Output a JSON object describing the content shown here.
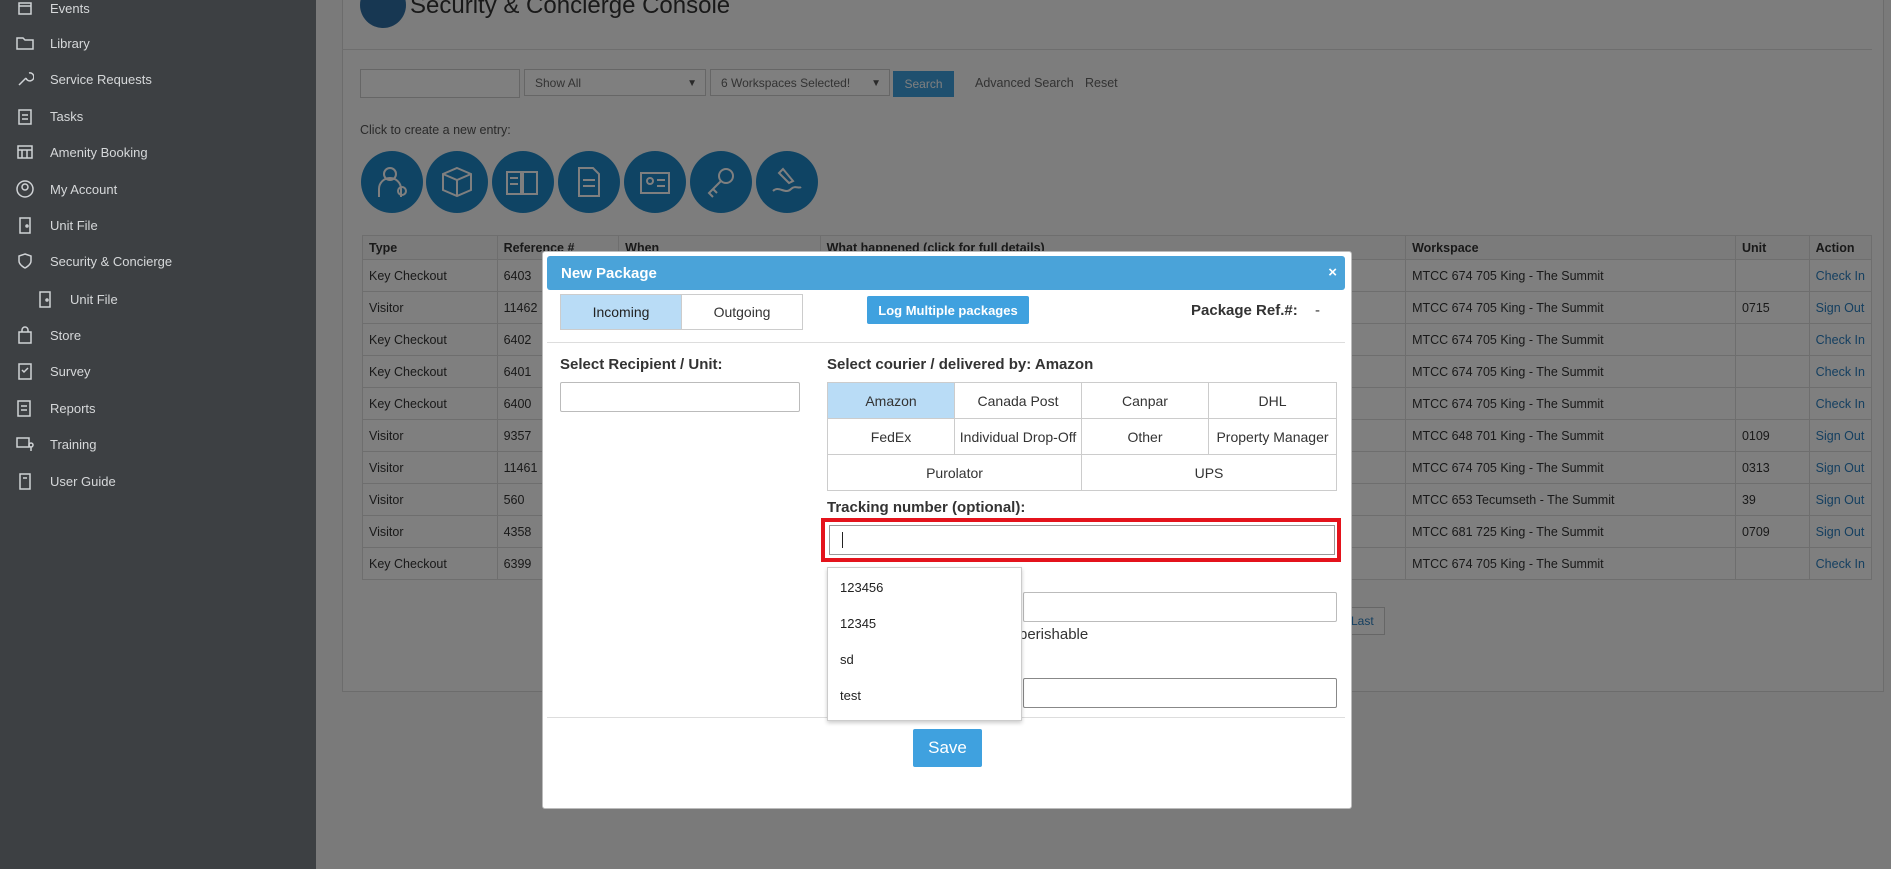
{
  "sidebar": {
    "items": [
      {
        "label": "Events",
        "icon": "calendar-icon"
      },
      {
        "label": "Library",
        "icon": "folder-icon"
      },
      {
        "label": "Service Requests",
        "icon": "wrench-icon"
      },
      {
        "label": "Tasks",
        "icon": "clipboard-icon"
      },
      {
        "label": "Amenity Booking",
        "icon": "calendar-grid-icon"
      },
      {
        "label": "My Account",
        "icon": "user-circle-icon"
      },
      {
        "label": "Unit File",
        "icon": "door-icon"
      },
      {
        "label": "Security & Concierge",
        "icon": "shield-icon"
      },
      {
        "label": "Unit File",
        "icon": "door-icon"
      },
      {
        "label": "Store",
        "icon": "bag-icon"
      },
      {
        "label": "Survey",
        "icon": "survey-icon"
      },
      {
        "label": "Reports",
        "icon": "report-icon"
      },
      {
        "label": "Training",
        "icon": "training-icon"
      },
      {
        "label": "User Guide",
        "icon": "guide-icon"
      }
    ]
  },
  "header": {
    "title": "Security & Concierge Console"
  },
  "filters": {
    "search_value": "",
    "show": "Show All",
    "workspaces": "6 Workspaces Selected!",
    "search_button": "Search",
    "advanced_search": "Advanced Search",
    "reset": "Reset"
  },
  "hint": "Click to create a new entry:",
  "table": {
    "columns": [
      "Type",
      "Reference #",
      "When",
      "What happened (click for full details)",
      "Workspace",
      "Unit",
      "Action"
    ],
    "rows": [
      {
        "type": "Key Checkout",
        "ref": "6403",
        "workspace": "MTCC 674 705 King - The Summit",
        "unit": "",
        "action": "Check In"
      },
      {
        "type": "Visitor",
        "ref": "11462",
        "workspace": "MTCC 674 705 King - The Summit",
        "unit": "0715",
        "action": "Sign Out"
      },
      {
        "type": "Key Checkout",
        "ref": "6402",
        "workspace": "MTCC 674 705 King - The Summit",
        "unit": "",
        "action": "Check In"
      },
      {
        "type": "Key Checkout",
        "ref": "6401",
        "workspace": "MTCC 674 705 King - The Summit",
        "unit": "",
        "action": "Check In"
      },
      {
        "type": "Key Checkout",
        "ref": "6400",
        "workspace": "MTCC 674 705 King - The Summit",
        "unit": "",
        "action": "Check In"
      },
      {
        "type": "Visitor",
        "ref": "9357",
        "workspace": "MTCC 648 701 King - The Summit",
        "unit": "0109",
        "action": "Sign Out"
      },
      {
        "type": "Visitor",
        "ref": "11461",
        "workspace": "MTCC 674 705 King - The Summit",
        "unit": "0313",
        "action": "Sign Out"
      },
      {
        "type": "Visitor",
        "ref": "560",
        "workspace": "MTCC 653 Tecumseth - The Summit",
        "unit": "39",
        "action": "Sign Out"
      },
      {
        "type": "Visitor",
        "ref": "4358",
        "workspace": "MTCC 681 725 King - The Summit",
        "unit": "0709",
        "action": "Sign Out"
      },
      {
        "type": "Key Checkout",
        "ref": "6399",
        "workspace": "MTCC 674 705 King - The Summit",
        "unit": "",
        "action": "Check In"
      }
    ],
    "pager_last": "Last"
  },
  "modal": {
    "title": "New Package",
    "close": "×",
    "tabs": {
      "incoming": "Incoming",
      "outgoing": "Outgoing"
    },
    "log_multiple": "Log Multiple packages",
    "ref_label": "Package Ref.#:",
    "ref_value": "-",
    "recipient_label": "Select Recipient / Unit:",
    "recipient_value": "",
    "courier_label": "Select courier / delivered by:",
    "courier_selected": "Amazon",
    "couriers": [
      "Amazon",
      "Canada Post",
      "Canpar",
      "DHL",
      "FedEx",
      "Individual Drop-Off",
      "Other",
      "Property Manager",
      "Purolator",
      "UPS"
    ],
    "tracking_label": "Tracking number (optional):",
    "tracking_value": "",
    "perishable_partial": "perishable",
    "suggestions": [
      "123456",
      "12345",
      "sd",
      "test"
    ],
    "save": "Save"
  },
  "colors": {
    "accent": "#3fa1df",
    "selected": "#b9dcf6",
    "highlight": "#e4131c",
    "sidebar": "#3d4043"
  }
}
